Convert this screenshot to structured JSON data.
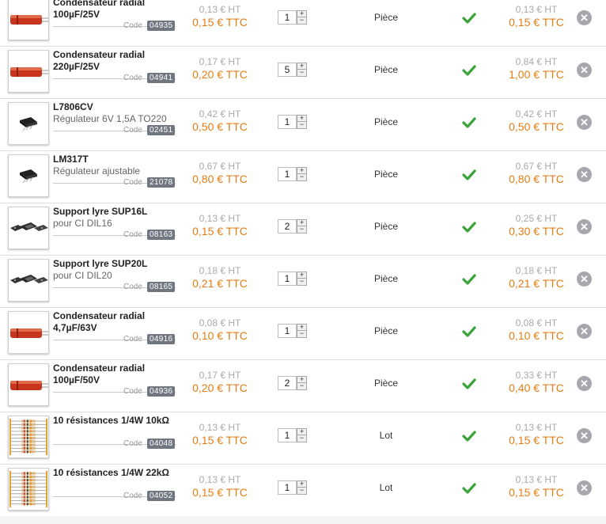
{
  "labels": {
    "code": "Code"
  },
  "colors": {
    "accent_orange": "#e57d14",
    "check_green": "#3aa33a",
    "code_bg": "#707780"
  },
  "rows": [
    {
      "name": "Condensateur radial",
      "sub": "100µF/25V",
      "sub_bold": true,
      "code": "04935",
      "image": "capacitor",
      "unit_ht": "0,13 € HT",
      "unit_ttc": "0,15 € TTC",
      "qty": "1",
      "unit": "Pièce",
      "total_ht": "0,13 € HT",
      "total_ttc": "0,15 € TTC"
    },
    {
      "name": "Condensateur radial",
      "sub": "220µF/25V",
      "sub_bold": true,
      "code": "04941",
      "image": "capacitor",
      "unit_ht": "0,17 € HT",
      "unit_ttc": "0,20 € TTC",
      "qty": "5",
      "unit": "Pièce",
      "total_ht": "0,84 € HT",
      "total_ttc": "1,00 € TTC"
    },
    {
      "name": "L7806CV",
      "sub": "Régulateur 6V 1,5A TO220",
      "sub_bold": false,
      "code": "02451",
      "image": "regulator",
      "unit_ht": "0,42 € HT",
      "unit_ttc": "0,50 € TTC",
      "qty": "1",
      "unit": "Pièce",
      "total_ht": "0,42 € HT",
      "total_ttc": "0,50 € TTC"
    },
    {
      "name": "LM317T",
      "sub": "Régulateur ajustable",
      "sub_bold": false,
      "code": "21078",
      "image": "regulator",
      "unit_ht": "0,67 € HT",
      "unit_ttc": "0,80 € TTC",
      "qty": "1",
      "unit": "Pièce",
      "total_ht": "0,67 € HT",
      "total_ttc": "0,80 € TTC"
    },
    {
      "name": "Support lyre SUP16L",
      "sub": "pour CI DIL16",
      "sub_bold": false,
      "code": "08163",
      "image": "socket",
      "unit_ht": "0,13 € HT",
      "unit_ttc": "0,15 € TTC",
      "qty": "2",
      "unit": "Pièce",
      "total_ht": "0,25 € HT",
      "total_ttc": "0,30 € TTC"
    },
    {
      "name": "Support lyre SUP20L",
      "sub": "pour CI DIL20",
      "sub_bold": false,
      "code": "08165",
      "image": "socket",
      "unit_ht": "0,18 € HT",
      "unit_ttc": "0,21 € TTC",
      "qty": "1",
      "unit": "Pièce",
      "total_ht": "0,18 € HT",
      "total_ttc": "0,21 € TTC"
    },
    {
      "name": "Condensateur radial",
      "sub": "4,7µF/63V",
      "sub_bold": true,
      "code": "04916",
      "image": "capacitor",
      "unit_ht": "0,08 € HT",
      "unit_ttc": "0,10 € TTC",
      "qty": "1",
      "unit": "Pièce",
      "total_ht": "0,08 € HT",
      "total_ttc": "0,10 € TTC"
    },
    {
      "name": "Condensateur radial",
      "sub": "100µF/50V",
      "sub_bold": true,
      "code": "04936",
      "image": "capacitor",
      "unit_ht": "0,17 € HT",
      "unit_ttc": "0,20 € TTC",
      "qty": "2",
      "unit": "Pièce",
      "total_ht": "0,33 € HT",
      "total_ttc": "0,40 € TTC"
    },
    {
      "name": "10 résistances 1/4W 10kΩ",
      "sub": "",
      "sub_bold": false,
      "code": "04048",
      "image": "resistors",
      "unit_ht": "0,13 € HT",
      "unit_ttc": "0,15 € TTC",
      "qty": "1",
      "unit": "Lot",
      "total_ht": "0,13 € HT",
      "total_ttc": "0,15 € TTC"
    },
    {
      "name": "10 résistances 1/4W 22kΩ",
      "sub": "",
      "sub_bold": false,
      "code": "04052",
      "image": "resistors",
      "unit_ht": "0,13 € HT",
      "unit_ttc": "0,15 € TTC",
      "qty": "1",
      "unit": "Lot",
      "total_ht": "0,13 € HT",
      "total_ttc": "0,15 € TTC"
    }
  ]
}
